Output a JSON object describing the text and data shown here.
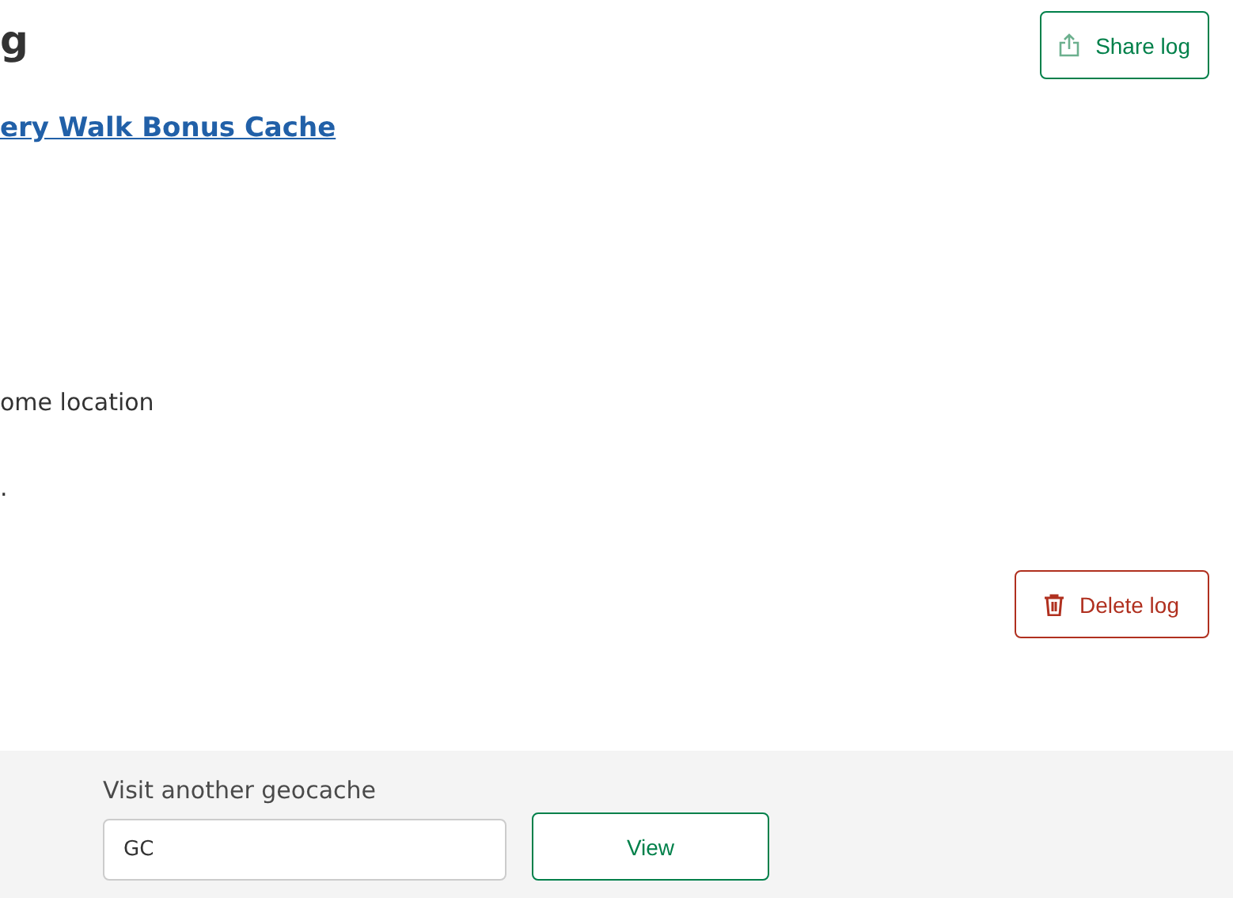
{
  "heading": "g",
  "cache_link": "ery Walk Bonus Cache",
  "share_button": "Share log",
  "lines": [
    "ome location",
    "."
  ],
  "delete_button": "Delete log",
  "visit": {
    "label": "Visit another geocache",
    "value": "GC",
    "button": "View"
  }
}
